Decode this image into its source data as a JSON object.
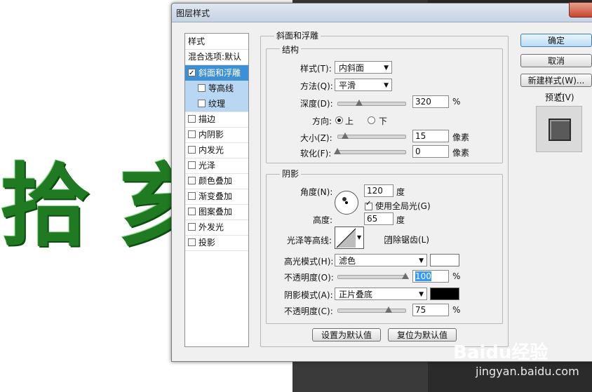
{
  "background": {
    "characters": [
      "拾",
      "亥"
    ],
    "char_color": "#1f7a22"
  },
  "dialog": {
    "title": "图层样式",
    "buttons": {
      "ok": "确定",
      "cancel": "取消",
      "new_style": "新建样式(W)...",
      "preview": "预览(V)"
    },
    "left_list": {
      "header": "样式",
      "blend": "混合选项:默认",
      "items": [
        {
          "label": "斜面和浮雕",
          "checked": true
        },
        {
          "label": "等高线",
          "checked": false
        },
        {
          "label": "纹理",
          "checked": false
        },
        {
          "label": "描边",
          "checked": false
        },
        {
          "label": "内阴影",
          "checked": false
        },
        {
          "label": "内发光",
          "checked": false
        },
        {
          "label": "光泽",
          "checked": false
        },
        {
          "label": "颜色叠加",
          "checked": false
        },
        {
          "label": "渐变叠加",
          "checked": false
        },
        {
          "label": "图案叠加",
          "checked": false
        },
        {
          "label": "外发光",
          "checked": false
        },
        {
          "label": "投影",
          "checked": false
        }
      ]
    },
    "bevel": {
      "section_title": "斜面和浮雕",
      "structure_title": "结构",
      "style_label": "样式(T):",
      "style_value": "内斜面",
      "technique_label": "方法(Q):",
      "technique_value": "平滑",
      "depth_label": "深度(D):",
      "depth_value": "320",
      "depth_unit": "%",
      "direction_label": "方向:",
      "direction_up": "上",
      "direction_down": "下",
      "size_label": "大小(Z):",
      "size_value": "15",
      "size_unit": "像素",
      "soften_label": "软化(F):",
      "soften_value": "0",
      "soften_unit": "像素"
    },
    "shading": {
      "title": "阴影",
      "angle_label": "角度(N):",
      "angle_value": "120",
      "angle_unit": "度",
      "global_light_label": "使用全局光(G)",
      "altitude_label": "高度:",
      "altitude_value": "65",
      "altitude_unit": "度",
      "gloss_label": "光泽等高线:",
      "antialias_label": "消除锯齿(L)",
      "highlight_label": "高光模式(H):",
      "highlight_mode": "滤色",
      "highlight_color": "#ffffff",
      "opacity1_label": "不透明度(O):",
      "opacity1_value": "100",
      "opacity1_unit": "%",
      "shadow_label": "阴影模式(A):",
      "shadow_mode": "正片叠底",
      "shadow_color": "#000000",
      "opacity2_label": "不透明度(C):",
      "opacity2_value": "75",
      "opacity2_unit": "%"
    },
    "footer": {
      "make_default": "设置为默认值",
      "reset_default": "复位为默认值"
    }
  },
  "watermark": {
    "brand": "Baidu经验",
    "url": "jingyan.baidu.com"
  }
}
